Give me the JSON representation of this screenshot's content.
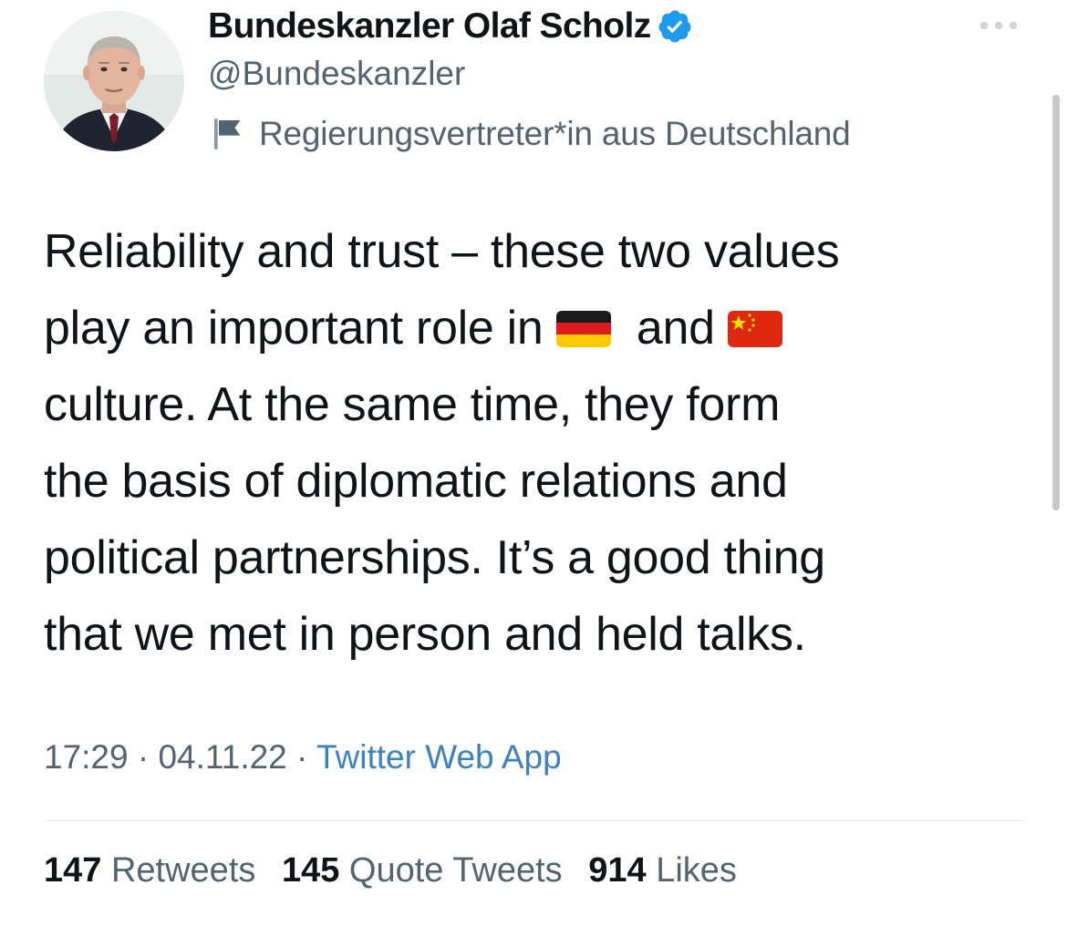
{
  "author": {
    "display_name": "Bundeskanzler Olaf Scholz",
    "handle": "@Bundeskanzler",
    "label": "Regierungsvertreter*in aus Deutschland"
  },
  "icons": {
    "verified": "verified-badge-icon",
    "label_flag": "flag-icon",
    "more": "more-options-icon"
  },
  "colors": {
    "verified": "#1d9bf0",
    "link": "#3b82c4",
    "secondary_text": "#536471"
  },
  "tweet": {
    "line1": "Reliability and trust – these two values",
    "line2_a": "play an important role in",
    "line2_b": "and",
    "line3": "culture. At the same time, they form",
    "line4": "the basis of diplomatic relations and",
    "line5": "political partnerships. It’s a good thing",
    "line6": "that we met in person and held talks.",
    "emoji_1": "germany-flag",
    "emoji_2": "china-flag"
  },
  "meta": {
    "time": "17:29",
    "separator": " · ",
    "date": "04.11.22",
    "source": "Twitter Web App"
  },
  "stats": [
    {
      "count": "147",
      "label": "Retweets"
    },
    {
      "count": "145",
      "label": "Quote Tweets"
    },
    {
      "count": "914",
      "label": "Likes"
    }
  ]
}
